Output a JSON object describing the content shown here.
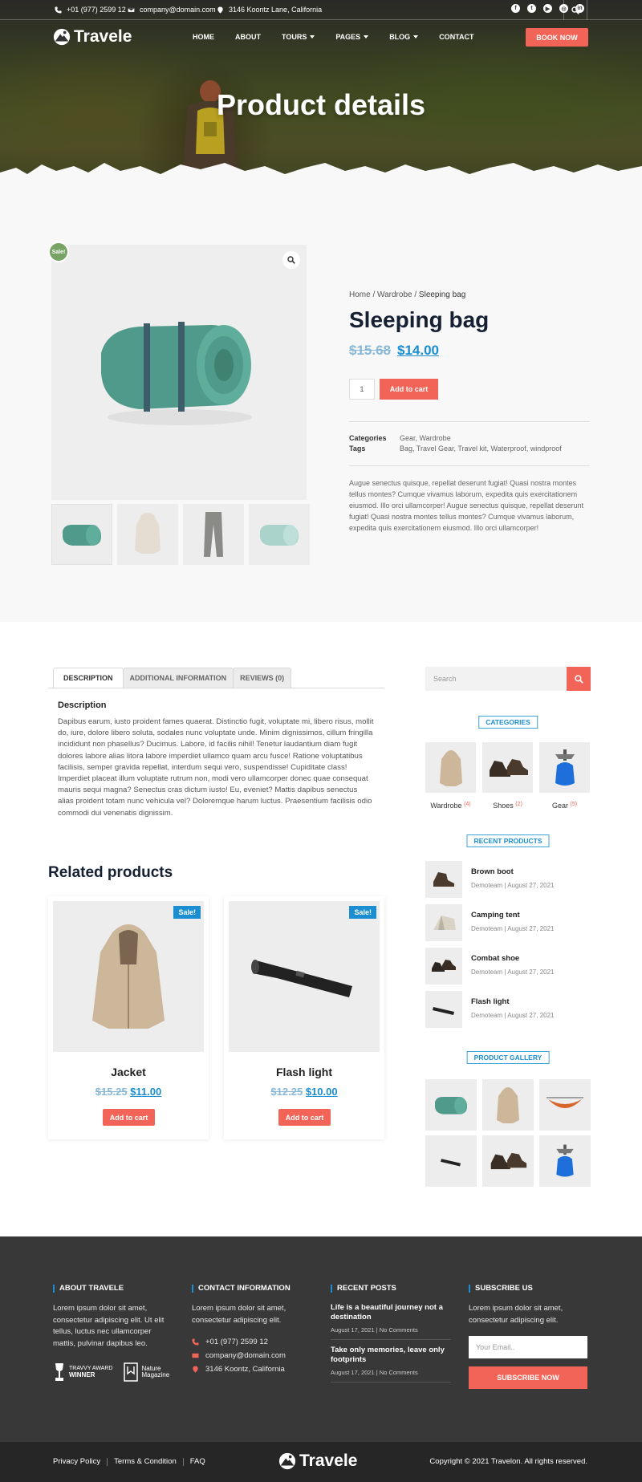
{
  "topbar": {
    "phone": "+01 (977) 2599 12",
    "email": "company@domain.com",
    "address": "3146 Koontz Lane, California",
    "social_icons": [
      "facebook-icon",
      "twitter-icon",
      "youtube-icon",
      "instagram-icon",
      "linkedin-icon"
    ]
  },
  "nav": {
    "logo_text": "Travele",
    "items": [
      {
        "label": "HOME",
        "dropdown": false
      },
      {
        "label": "ABOUT",
        "dropdown": false
      },
      {
        "label": "TOURS",
        "dropdown": true
      },
      {
        "label": "PAGES",
        "dropdown": true
      },
      {
        "label": "BLOG",
        "dropdown": true
      },
      {
        "label": "CONTACT",
        "dropdown": false
      }
    ],
    "book_label": "BOOK NOW"
  },
  "hero": {
    "title": "Product details"
  },
  "product": {
    "sale_badge": "Sale!",
    "breadcrumb": {
      "home": "Home",
      "category": "Wardrobe",
      "current": "Sleeping bag",
      "sep": " / "
    },
    "title": "Sleeping bag",
    "old_price": "$15.68",
    "new_price": "$14.00",
    "quantity": "1",
    "add_to_cart": "Add to cart",
    "categories_label": "Categories",
    "categories_value": "Gear, Wardrobe",
    "tags_label": "Tags",
    "tags_value": "Bag, Travel Gear, Travel kit, Waterproof, windproof",
    "short_description": "Augue senectus quisque, repellat deserunt fugiat! Quasi nostra montes tellus montes? Cumque vivamus laborum, expedita quis exercitationem eiusmod. Illo orci ullamcorper! Augue senectus quisque, repellat deserunt fugiat! Quasi nostra montes tellus montes? Cumque vivamus laborum, expedita quis exercitationem eiusmod. Illo orci ullamcorper!"
  },
  "tabs": {
    "items": [
      "DESCRIPTION",
      "ADDITIONAL INFORMATION",
      "REVIEWS (0)"
    ],
    "description_heading": "Description",
    "description_body": "Dapibus earum, iusto proident fames quaerat. Distinctio fugit, voluptate mi, libero risus, mollit do, iure, dolore libero soluta, sodales nunc voluptate unde. Minim dignissimos, cillum fringilla incididunt non phasellus? Ducimus. Labore, id facilis nihil! Tenetur laudantium diam fugit dolores labore alias litora labore imperdiet ullamco quam arcu fusce! Ratione voluptatibus facilisis, semper gravida repellat, interdum sequi vero, suspendisse! Cupiditate class! Imperdiet placeat illum voluptate rutrum non, modi vero ullamcorper donec quae consequat mauris sequi magna? Senectus cras dictum iusto! Eu, eveniet? Mattis dapibus senectus alias proident totam nunc vehicula vel? Doloremque harum luctus. Praesentium facilisis odio commodi dui venenatis dignissim."
  },
  "related": {
    "heading": "Related products",
    "items": [
      {
        "sale": "Sale!",
        "name": "Jacket",
        "old_price": "$15.25",
        "new_price": "$11.00",
        "button": "Add to cart"
      },
      {
        "sale": "Sale!",
        "name": "Flash light",
        "old_price": "$12.25",
        "new_price": "$10.00",
        "button": "Add to cart"
      }
    ]
  },
  "sidebar": {
    "search_placeholder": "Search",
    "categories_title": "CATEGORIES",
    "categories": [
      {
        "name": "Wardrobe",
        "count": "(4)"
      },
      {
        "name": "Shoes",
        "count": "(2)"
      },
      {
        "name": "Gear",
        "count": "(5)"
      }
    ],
    "recent_title": "RECENT PRODUCTS",
    "recent": [
      {
        "name": "Brown boot",
        "author": "Demoteam",
        "date": "August 27, 2021"
      },
      {
        "name": "Camping tent",
        "author": "Demoteam",
        "date": "August 27, 2021"
      },
      {
        "name": "Combat shoe",
        "author": "Demoteam",
        "date": "August 27, 2021"
      },
      {
        "name": "Flash light",
        "author": "Demoteam",
        "date": "August 27, 2021"
      }
    ],
    "meta_sep": "|",
    "gallery_title": "PRODUCT GALLERY"
  },
  "footer": {
    "about_title": "ABOUT TRAVELE",
    "about_text": "Lorem ipsum dolor sit amet, consectetur adipiscing elit. Ut elit tellus, luctus nec ullamcorper mattis, pulvinar dapibus leo.",
    "award1_line1": "TRAVVY AWARD",
    "award1_line2": "WINNER",
    "award2_line1": "Nature",
    "award2_line2": "Magazine",
    "contact_title": "CONTACT INFORMATION",
    "contact_text": "Lorem ipsum dolor sit amet, consectetur adipiscing elit.",
    "phone": "+01 (977) 2599 12",
    "email": "company@domain.com",
    "address": "3146 Koontz, California",
    "posts_title": "RECENT POSTS",
    "posts": [
      {
        "title": "Life is a beautiful journey not a destination",
        "date": "August 17, 2021",
        "comments": "No Comments"
      },
      {
        "title": "Take only memories, leave only footprints",
        "date": "August 17, 2021",
        "comments": "No Comments"
      }
    ],
    "subscribe_title": "SUBSCRIBE US",
    "subscribe_text": "Lorem ipsum dolor sit amet, consectetur adipiscing elit.",
    "email_placeholder": "Your Email..",
    "subscribe_button": "SUBSCRIBE NOW"
  },
  "bottom": {
    "links": [
      "Privacy Policy",
      "Terms & Condition",
      "FAQ"
    ],
    "logo_text": "Travele",
    "copyright": "Copyright © 2021 Travelon. All rights reserved."
  },
  "colors": {
    "accent": "#f26457",
    "link": "#1a8ed1",
    "sale_green": "#77a464",
    "heading": "#152033",
    "footer_bg": "#383838"
  }
}
